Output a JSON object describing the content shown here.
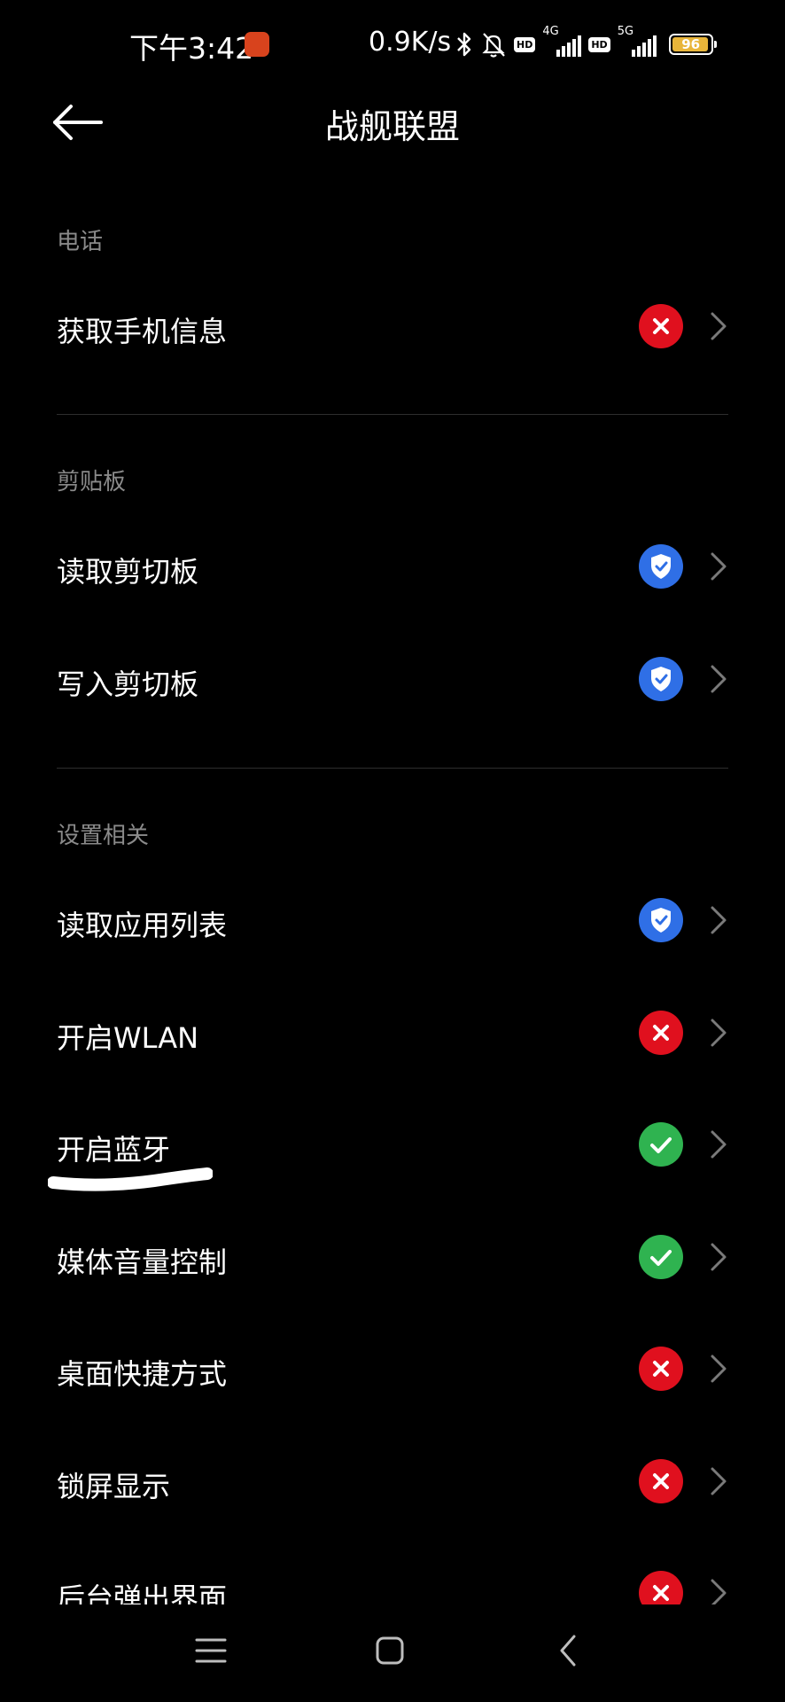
{
  "status_bar": {
    "time": "下午3:42",
    "net_speed": "0.9K/s",
    "hd_badge_1": "HD",
    "network_1": "4G",
    "hd_badge_2": "HD",
    "network_2": "5G",
    "battery": "96",
    "battery_fraction": 0.96,
    "battery_color": "#e8b53a"
  },
  "header": {
    "title": "战舰联盟"
  },
  "sections": [
    {
      "title": "电话",
      "items": [
        {
          "label": "获取手机信息",
          "status": "denied"
        }
      ]
    },
    {
      "title": "剪贴板",
      "items": [
        {
          "label": "读取剪切板",
          "status": "ask"
        },
        {
          "label": "写入剪切板",
          "status": "ask"
        }
      ]
    },
    {
      "title": "设置相关",
      "items": [
        {
          "label": "读取应用列表",
          "status": "ask"
        },
        {
          "label": "开启WLAN",
          "status": "denied"
        },
        {
          "label": "开启蓝牙",
          "status": "allowed"
        },
        {
          "label": "媒体音量控制",
          "status": "allowed"
        },
        {
          "label": "桌面快捷方式",
          "status": "denied"
        },
        {
          "label": "锁屏显示",
          "status": "denied"
        },
        {
          "label": "后台弹出界面",
          "status": "denied"
        }
      ]
    }
  ],
  "status_colors": {
    "denied": "#e0101e",
    "ask": "#2f6fe6",
    "allowed": "#2fb350"
  },
  "status_icons": {
    "denied": "x-circle-icon",
    "ask": "shield-check-icon",
    "allowed": "check-circle-icon"
  },
  "nav": {
    "menu": "menu-icon",
    "home": "home-icon",
    "back": "back-icon"
  }
}
